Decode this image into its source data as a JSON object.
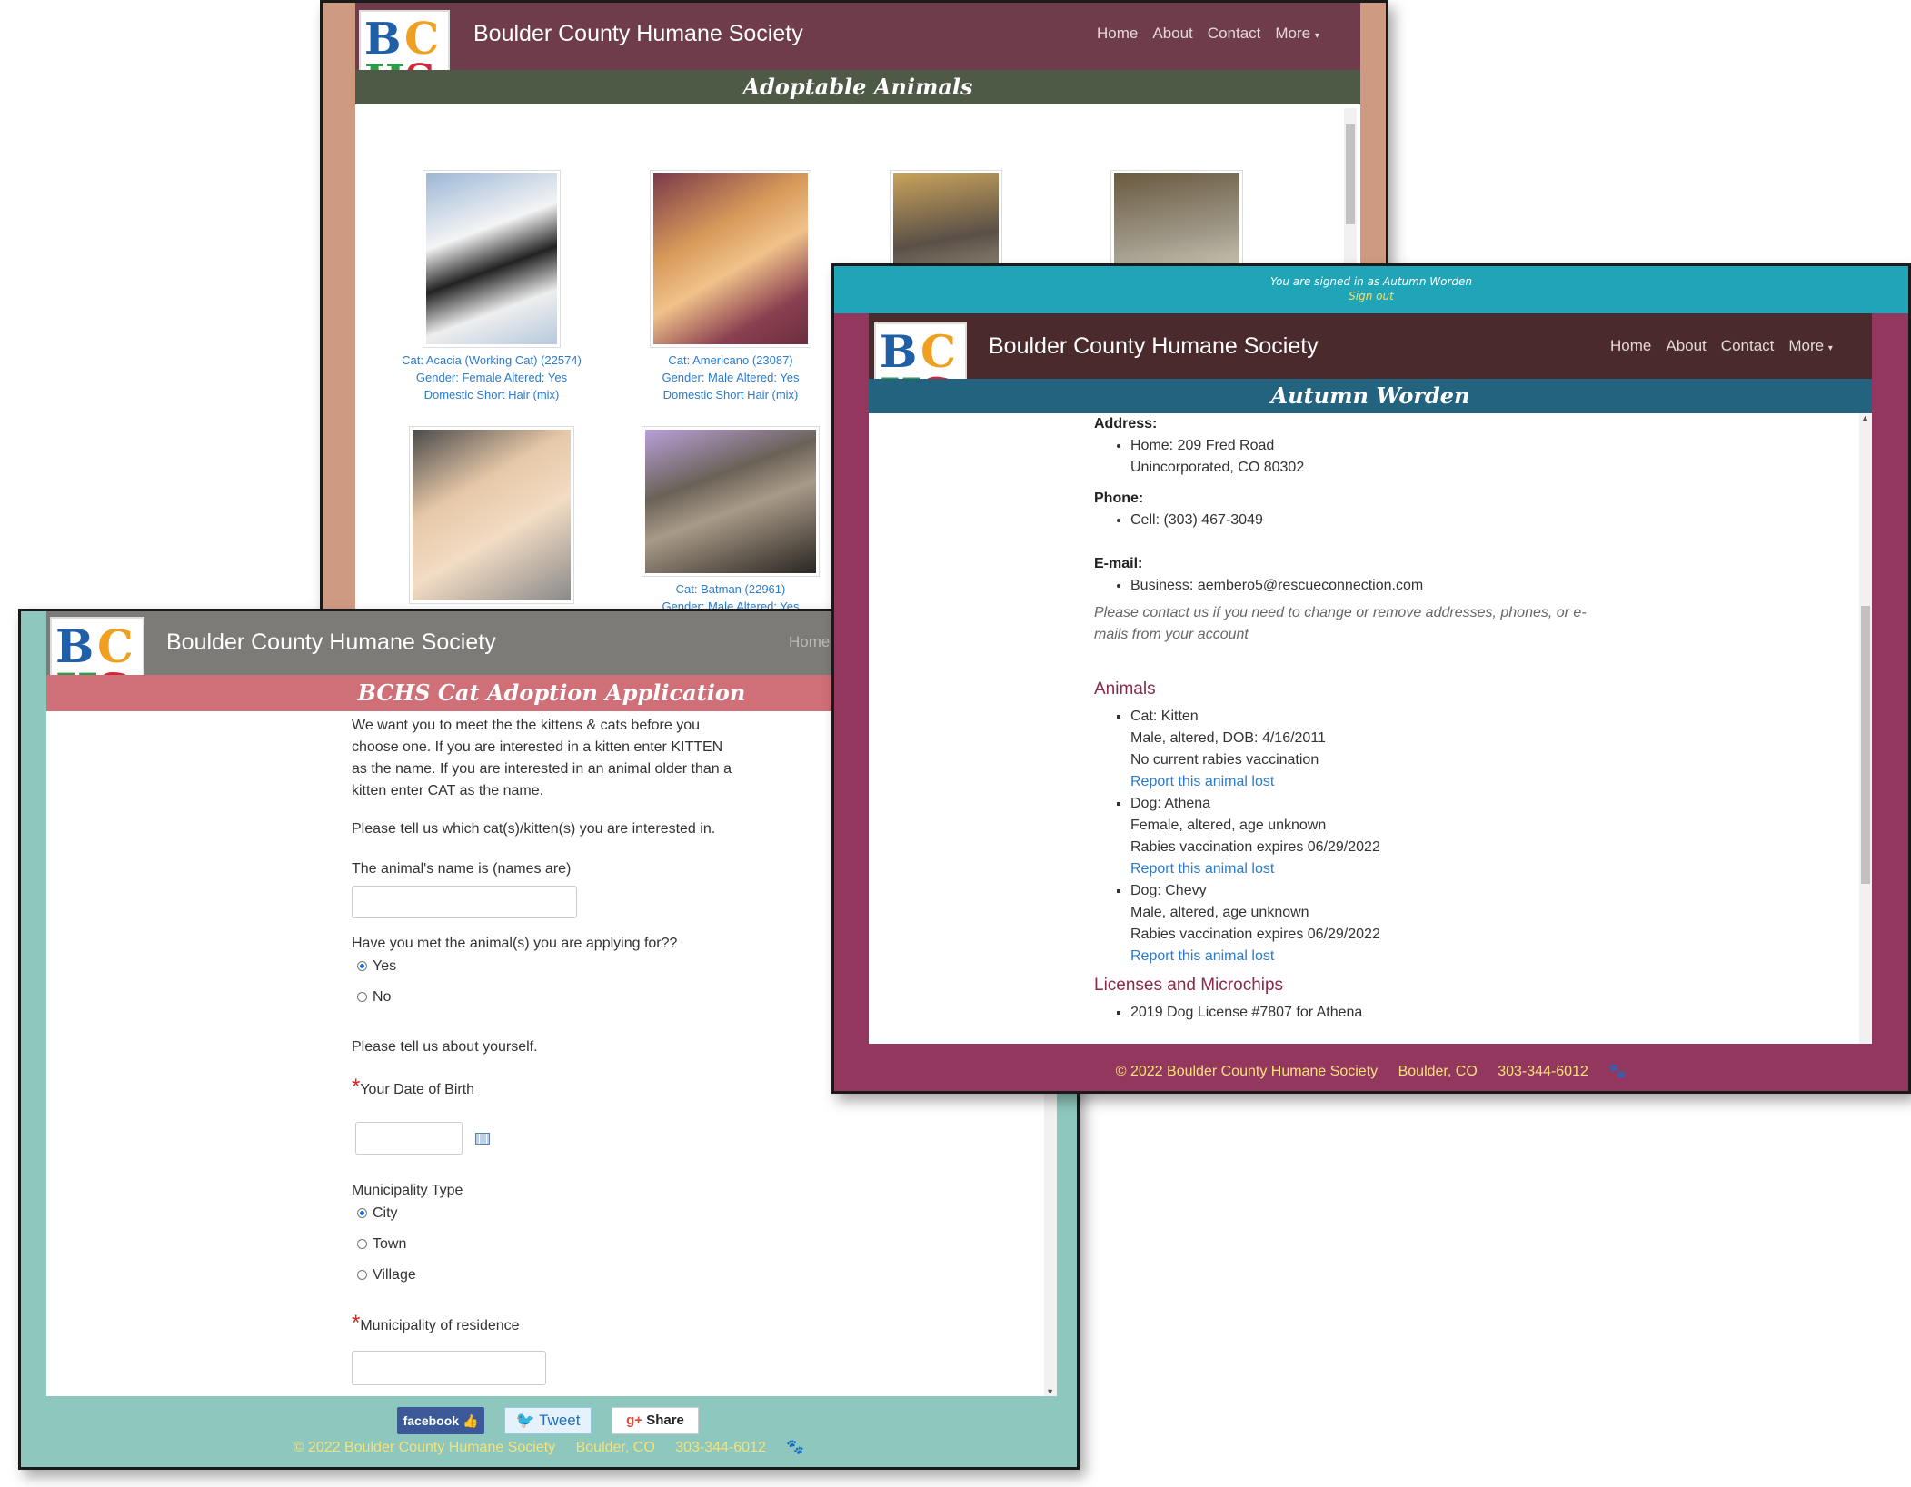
{
  "site_name": "Boulder County Humane Society",
  "nav": {
    "home": "Home",
    "about": "About",
    "contact": "Contact",
    "more": "More"
  },
  "logo": {
    "letters": [
      "B",
      "C",
      "H",
      "S"
    ]
  },
  "adoptable": {
    "banner": "Adoptable Animals",
    "cats": [
      {
        "line1": "Cat: Acacia (Working Cat) (22574)",
        "line2": "Gender: Female  Altered: Yes",
        "line3": "Domestic Short Hair (mix)"
      },
      {
        "line1": "Cat: Americano (23087)",
        "line2": "Gender: Male  Altered: Yes",
        "line3": "Domestic Short Hair (mix)"
      },
      {
        "line1": "",
        "line2": "",
        "line3": ""
      },
      {
        "line1": "",
        "line2": "",
        "line3": ""
      },
      {
        "line1": "",
        "line2": "",
        "line3": ""
      },
      {
        "line1": "Cat: Batman (22961)",
        "line2": "Gender: Male  Altered: Yes",
        "line3": ""
      }
    ]
  },
  "application": {
    "banner": "BCHS Cat Adoption Application",
    "nav_home": "Home",
    "intro": "We want you to meet the the kittens & cats before you choose one. If you are interested in a kitten enter KITTEN as the name. If you are interested in an animal older than a kitten enter CAT as the name.",
    "tell_cats": "Please tell us which cat(s)/kitten(s) you are interested in.",
    "animal_name_label": "The animal's name is (names are)",
    "met_question": "Have you met the animal(s) you are applying for??",
    "met_yes": "Yes",
    "met_no": "No",
    "tell_yourself": "Please tell us about yourself.",
    "required_mark": "*",
    "dob_label": "Your Date of Birth",
    "muni_type_label": "Municipality Type",
    "muni_city": "City",
    "muni_town": "Town",
    "muni_village": "Village",
    "muni_residence_label": "Municipality of residence",
    "share": {
      "facebook": "facebook",
      "tweet": "Tweet",
      "gplus": "Share"
    },
    "footer": {
      "copyright": "© 2022 Boulder County Humane Society",
      "city": "Boulder, CO",
      "phone": "303-344-6012"
    }
  },
  "account": {
    "signed_in": "You are signed in as Autumn Worden",
    "sign_out": "Sign out",
    "banner": "Autumn Worden",
    "address_label": "Address:",
    "address_line1": "Home: 209 Fred Road",
    "address_line2": "Unincorporated, CO 80302",
    "phone_label": "Phone:",
    "phone_value": "Cell: (303) 467-3049",
    "email_label": "E-mail:",
    "email_value": "Business: aembero5@rescueconnection.com",
    "contact_note": "Please contact us if you need to change or remove addresses, phones, or e-mails from your account",
    "animals_heading": "Animals",
    "animals": [
      {
        "title": "Cat: Kitten",
        "detail": "Male, altered, DOB: 4/16/2011",
        "rabies": "No current rabies vaccination",
        "link": "Report this animal lost"
      },
      {
        "title": "Dog: Athena",
        "detail": "Female, altered, age unknown",
        "rabies": "Rabies vaccination expires 06/29/2022",
        "link": "Report this animal lost"
      },
      {
        "title": "Dog: Chevy",
        "detail": "Male, altered, age unknown",
        "rabies": "Rabies vaccination expires 06/29/2022",
        "link": "Report this animal lost"
      }
    ],
    "licenses_heading": "Licenses and Microchips",
    "license_1": "2019 Dog License #7807 for Athena",
    "footer": {
      "copyright": "© 2022 Boulder County Humane Society",
      "city": "Boulder, CO",
      "phone": "303-344-6012"
    }
  }
}
